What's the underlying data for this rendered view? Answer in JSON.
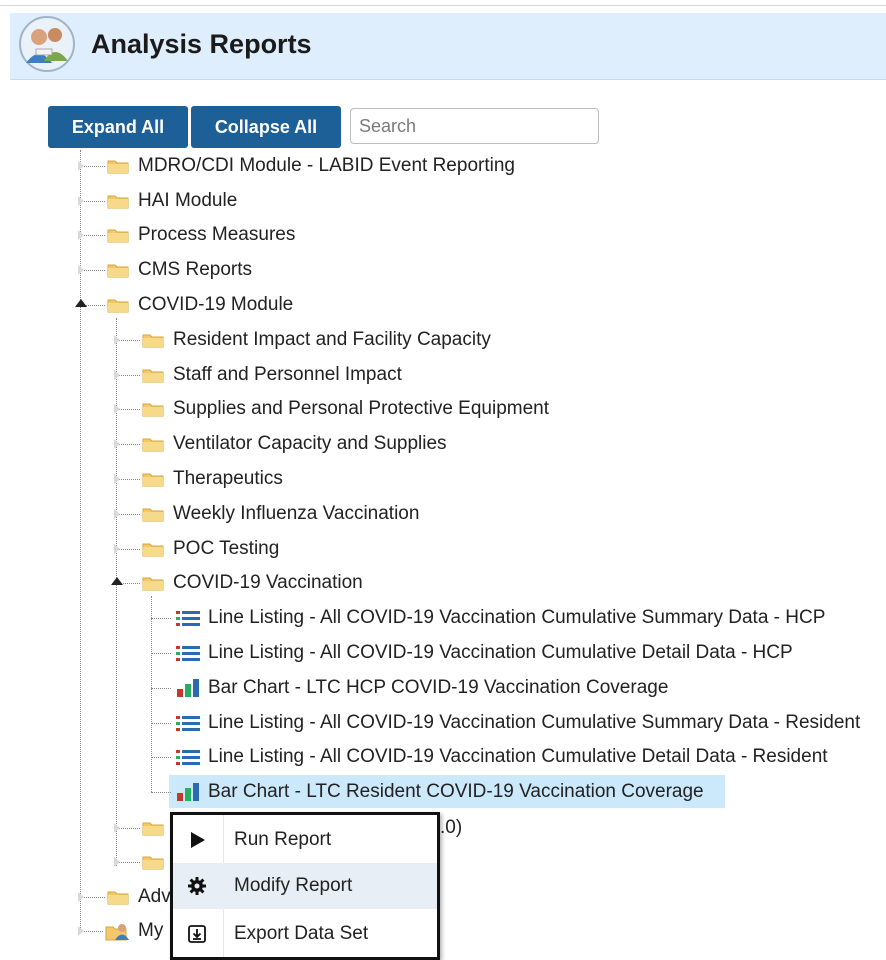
{
  "header": {
    "title": "Analysis Reports",
    "logo_icon": "people-logo-icon"
  },
  "toolbar": {
    "expand_label": "Expand All",
    "collapse_label": "Collapse All",
    "search_placeholder": "Search"
  },
  "tree": {
    "top": [
      "MDRO/CDI Module - LABID Event Reporting",
      "HAI Module",
      "Process Measures",
      "CMS Reports",
      "COVID-19 Module"
    ],
    "covid_children": [
      "Resident Impact and Facility Capacity",
      "Staff and Personnel Impact",
      "Supplies and Personal Protective Equipment",
      "Ventilator Capacity and Supplies",
      "Therapeutics",
      "Weekly Influenza Vaccination",
      "POC Testing",
      "COVID-19 Vaccination"
    ],
    "vaccination_reports": [
      {
        "label": "Line Listing - All COVID-19 Vaccination Cumulative Summary Data - HCP",
        "icon": "line-listing-icon"
      },
      {
        "label": "Line Listing - All COVID-19 Vaccination Cumulative Detail Data - HCP",
        "icon": "line-listing-icon"
      },
      {
        "label": "Bar Chart - LTC HCP COVID-19 Vaccination Coverage",
        "icon": "bar-chart-icon"
      },
      {
        "label": "Line Listing - All COVID-19 Vaccination Cumulative Summary Data - Resident",
        "icon": "line-listing-icon"
      },
      {
        "label": "Line Listing - All COVID-19 Vaccination Cumulative Detail Data - Resident",
        "icon": "line-listing-icon"
      },
      {
        "label": "Bar Chart - LTC Resident COVID-19 Vaccination Coverage",
        "icon": "bar-chart-icon"
      }
    ],
    "partial_after": [
      ".0)",
      "",
      ""
    ],
    "bottom": [
      "Adv",
      "My"
    ]
  },
  "context_menu": {
    "items": [
      {
        "label": "Run Report",
        "icon": "play-icon"
      },
      {
        "label": "Modify Report",
        "icon": "gear-icon"
      },
      {
        "label": "Export Data Set",
        "icon": "export-icon"
      }
    ]
  },
  "colors": {
    "button": "#1d5f97",
    "header_bg": "#dfeefc",
    "selected": "#cce8fb"
  }
}
